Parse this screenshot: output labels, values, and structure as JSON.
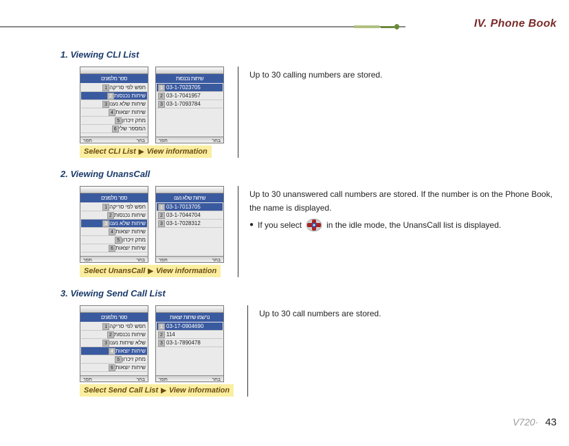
{
  "chapter": "IV. Phone Book",
  "footer": {
    "model": "V720·",
    "page": "43"
  },
  "sections": [
    {
      "title": "1. Viewing CLI List",
      "caption": {
        "left": "Select CLI List",
        "right": "View information"
      },
      "desc_main": "Up to 30 calling numbers are stored.",
      "desc_extra": null,
      "shot_left": {
        "title": "ספר מלפונים",
        "rows": [
          "חפש  לפי  סריקה",
          "שיחות נכנסות",
          "שיחות שלא נענו",
          "שיחות יוצאות",
          "מחק  זיכרון",
          "המספר  שלי"
        ],
        "hl_index": 1
      },
      "shot_right": {
        "title": "שיחות נכנסות",
        "rows": [
          "03-1-7023705",
          "03-1-7041957",
          "03-1-7093784"
        ],
        "hl_index": 0
      }
    },
    {
      "title": "2. Viewing UnansCall",
      "caption": {
        "left": "Select UnansCall",
        "right": "View information"
      },
      "desc_main": "Up to 30 unanswered call numbers are stored. If the number is on the Phone Book, the name is displayed.",
      "desc_extra": {
        "pre": "If you select",
        "post": "in the idle mode, the UnansCall list is displayed."
      },
      "shot_left": {
        "title": "ספר מלפונים",
        "rows": [
          "חפש  לפי  סריקה",
          "שיחות  נכנסות",
          "שיחות שלא נענו",
          "שיחות  יוצאות",
          "מחק  זיכרון",
          "שיחות יוצאות"
        ],
        "hl_index": 2
      },
      "shot_right": {
        "title": "שיחות שלא נענו",
        "rows": [
          "03-1-7013705",
          "03-1-7044704",
          "03-1-7028312"
        ],
        "hl_index": 0
      }
    },
    {
      "title": "3. Viewing Send Call List",
      "caption": {
        "left": "Select Send Call List",
        "right": "View information"
      },
      "desc_main": "Up to 30 call numbers are stored.",
      "desc_extra": null,
      "shot_left": {
        "title": "ספר מלפונים",
        "rows": [
          "חפש לפי סריקה",
          "שיחות נכנסות",
          "שלא שיחות נענו",
          "שיחות יוצאות",
          "מחק זיכרון",
          "שיחות יוצאות"
        ],
        "hl_index": 3
      },
      "shot_right": {
        "title": "נרשמו שיחות יוצאות",
        "rows": [
          "03-17-0904690",
          "114",
          "03-1-7890478"
        ],
        "hl_index": 0
      }
    }
  ]
}
